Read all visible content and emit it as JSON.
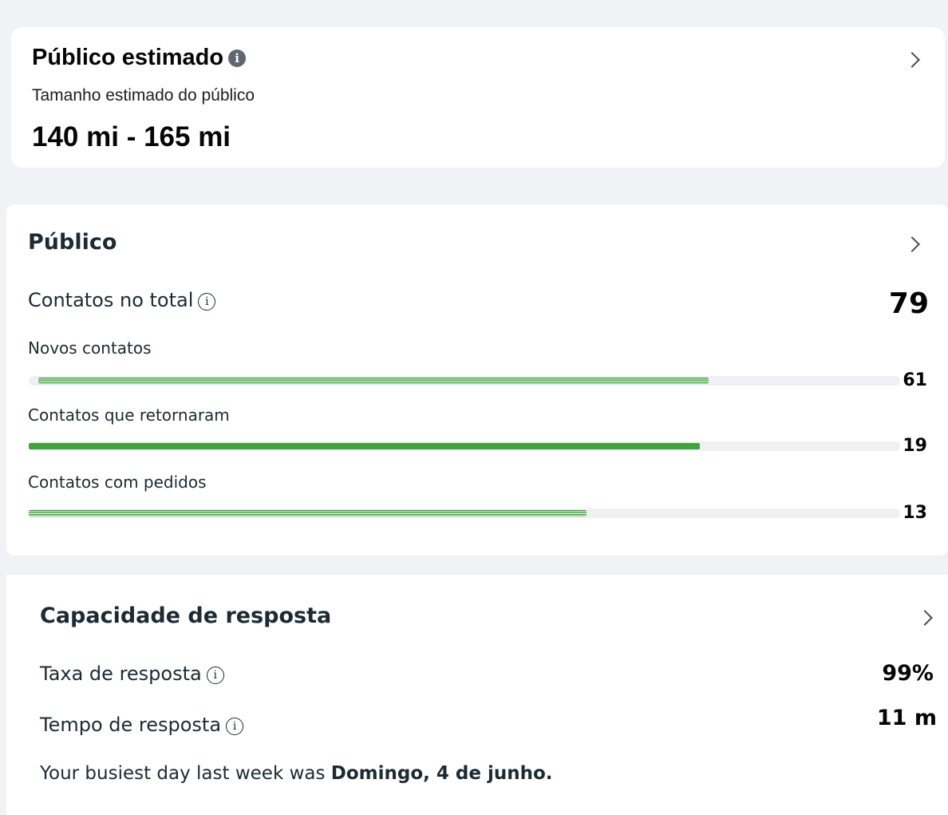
{
  "estimated_audience": {
    "title": "Público estimado",
    "subtitle": "Tamanho estimado do público",
    "range": "140 mi - 165 mi"
  },
  "audience": {
    "title": "Público",
    "total_label": "Contatos no total",
    "total_value": "79",
    "bars": [
      {
        "label": "Novos contatos",
        "value": "61",
        "fill_fraction": 0.78
      },
      {
        "label": "Contatos que retornaram",
        "value": "19",
        "fill_fraction": 0.77
      },
      {
        "label": "Contatos com pedidos",
        "value": "13",
        "fill_fraction": 0.64
      }
    ]
  },
  "responsiveness": {
    "title": "Capacidade de resposta",
    "rate_label": "Taxa de resposta",
    "rate_value": "99%",
    "time_label": "Tempo de resposta",
    "time_value": "11 m",
    "busiest_prefix": "Your busiest day last week was ",
    "busiest_day": "Domingo, 4 de junho."
  },
  "icons": {
    "info": "info-icon",
    "chevron": "chevron-right-icon"
  },
  "colors": {
    "bar_fill": "#41a33e",
    "bar_track": "#eef0f3",
    "background": "#f0f2f5"
  }
}
